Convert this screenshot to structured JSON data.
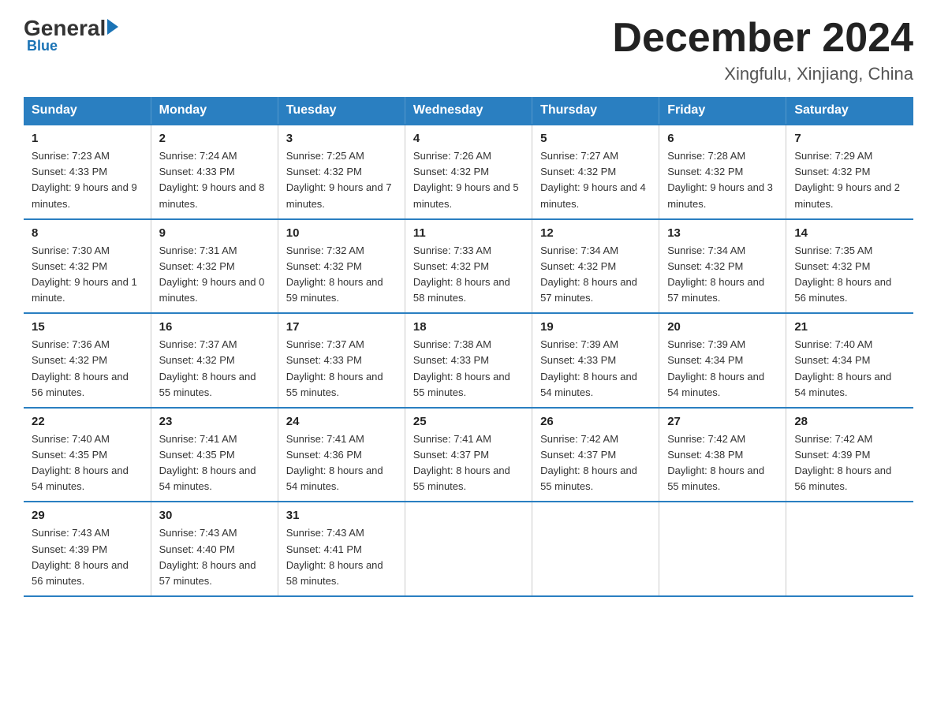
{
  "logo": {
    "general": "General",
    "blue": "Blue",
    "underline": "Blue"
  },
  "title": "December 2024",
  "location": "Xingfulu, Xinjiang, China",
  "days_of_week": [
    "Sunday",
    "Monday",
    "Tuesday",
    "Wednesday",
    "Thursday",
    "Friday",
    "Saturday"
  ],
  "weeks": [
    [
      {
        "day": "1",
        "sunrise": "Sunrise: 7:23 AM",
        "sunset": "Sunset: 4:33 PM",
        "daylight": "Daylight: 9 hours and 9 minutes."
      },
      {
        "day": "2",
        "sunrise": "Sunrise: 7:24 AM",
        "sunset": "Sunset: 4:33 PM",
        "daylight": "Daylight: 9 hours and 8 minutes."
      },
      {
        "day": "3",
        "sunrise": "Sunrise: 7:25 AM",
        "sunset": "Sunset: 4:32 PM",
        "daylight": "Daylight: 9 hours and 7 minutes."
      },
      {
        "day": "4",
        "sunrise": "Sunrise: 7:26 AM",
        "sunset": "Sunset: 4:32 PM",
        "daylight": "Daylight: 9 hours and 5 minutes."
      },
      {
        "day": "5",
        "sunrise": "Sunrise: 7:27 AM",
        "sunset": "Sunset: 4:32 PM",
        "daylight": "Daylight: 9 hours and 4 minutes."
      },
      {
        "day": "6",
        "sunrise": "Sunrise: 7:28 AM",
        "sunset": "Sunset: 4:32 PM",
        "daylight": "Daylight: 9 hours and 3 minutes."
      },
      {
        "day": "7",
        "sunrise": "Sunrise: 7:29 AM",
        "sunset": "Sunset: 4:32 PM",
        "daylight": "Daylight: 9 hours and 2 minutes."
      }
    ],
    [
      {
        "day": "8",
        "sunrise": "Sunrise: 7:30 AM",
        "sunset": "Sunset: 4:32 PM",
        "daylight": "Daylight: 9 hours and 1 minute."
      },
      {
        "day": "9",
        "sunrise": "Sunrise: 7:31 AM",
        "sunset": "Sunset: 4:32 PM",
        "daylight": "Daylight: 9 hours and 0 minutes."
      },
      {
        "day": "10",
        "sunrise": "Sunrise: 7:32 AM",
        "sunset": "Sunset: 4:32 PM",
        "daylight": "Daylight: 8 hours and 59 minutes."
      },
      {
        "day": "11",
        "sunrise": "Sunrise: 7:33 AM",
        "sunset": "Sunset: 4:32 PM",
        "daylight": "Daylight: 8 hours and 58 minutes."
      },
      {
        "day": "12",
        "sunrise": "Sunrise: 7:34 AM",
        "sunset": "Sunset: 4:32 PM",
        "daylight": "Daylight: 8 hours and 57 minutes."
      },
      {
        "day": "13",
        "sunrise": "Sunrise: 7:34 AM",
        "sunset": "Sunset: 4:32 PM",
        "daylight": "Daylight: 8 hours and 57 minutes."
      },
      {
        "day": "14",
        "sunrise": "Sunrise: 7:35 AM",
        "sunset": "Sunset: 4:32 PM",
        "daylight": "Daylight: 8 hours and 56 minutes."
      }
    ],
    [
      {
        "day": "15",
        "sunrise": "Sunrise: 7:36 AM",
        "sunset": "Sunset: 4:32 PM",
        "daylight": "Daylight: 8 hours and 56 minutes."
      },
      {
        "day": "16",
        "sunrise": "Sunrise: 7:37 AM",
        "sunset": "Sunset: 4:32 PM",
        "daylight": "Daylight: 8 hours and 55 minutes."
      },
      {
        "day": "17",
        "sunrise": "Sunrise: 7:37 AM",
        "sunset": "Sunset: 4:33 PM",
        "daylight": "Daylight: 8 hours and 55 minutes."
      },
      {
        "day": "18",
        "sunrise": "Sunrise: 7:38 AM",
        "sunset": "Sunset: 4:33 PM",
        "daylight": "Daylight: 8 hours and 55 minutes."
      },
      {
        "day": "19",
        "sunrise": "Sunrise: 7:39 AM",
        "sunset": "Sunset: 4:33 PM",
        "daylight": "Daylight: 8 hours and 54 minutes."
      },
      {
        "day": "20",
        "sunrise": "Sunrise: 7:39 AM",
        "sunset": "Sunset: 4:34 PM",
        "daylight": "Daylight: 8 hours and 54 minutes."
      },
      {
        "day": "21",
        "sunrise": "Sunrise: 7:40 AM",
        "sunset": "Sunset: 4:34 PM",
        "daylight": "Daylight: 8 hours and 54 minutes."
      }
    ],
    [
      {
        "day": "22",
        "sunrise": "Sunrise: 7:40 AM",
        "sunset": "Sunset: 4:35 PM",
        "daylight": "Daylight: 8 hours and 54 minutes."
      },
      {
        "day": "23",
        "sunrise": "Sunrise: 7:41 AM",
        "sunset": "Sunset: 4:35 PM",
        "daylight": "Daylight: 8 hours and 54 minutes."
      },
      {
        "day": "24",
        "sunrise": "Sunrise: 7:41 AM",
        "sunset": "Sunset: 4:36 PM",
        "daylight": "Daylight: 8 hours and 54 minutes."
      },
      {
        "day": "25",
        "sunrise": "Sunrise: 7:41 AM",
        "sunset": "Sunset: 4:37 PM",
        "daylight": "Daylight: 8 hours and 55 minutes."
      },
      {
        "day": "26",
        "sunrise": "Sunrise: 7:42 AM",
        "sunset": "Sunset: 4:37 PM",
        "daylight": "Daylight: 8 hours and 55 minutes."
      },
      {
        "day": "27",
        "sunrise": "Sunrise: 7:42 AM",
        "sunset": "Sunset: 4:38 PM",
        "daylight": "Daylight: 8 hours and 55 minutes."
      },
      {
        "day": "28",
        "sunrise": "Sunrise: 7:42 AM",
        "sunset": "Sunset: 4:39 PM",
        "daylight": "Daylight: 8 hours and 56 minutes."
      }
    ],
    [
      {
        "day": "29",
        "sunrise": "Sunrise: 7:43 AM",
        "sunset": "Sunset: 4:39 PM",
        "daylight": "Daylight: 8 hours and 56 minutes."
      },
      {
        "day": "30",
        "sunrise": "Sunrise: 7:43 AM",
        "sunset": "Sunset: 4:40 PM",
        "daylight": "Daylight: 8 hours and 57 minutes."
      },
      {
        "day": "31",
        "sunrise": "Sunrise: 7:43 AM",
        "sunset": "Sunset: 4:41 PM",
        "daylight": "Daylight: 8 hours and 58 minutes."
      },
      null,
      null,
      null,
      null
    ]
  ]
}
